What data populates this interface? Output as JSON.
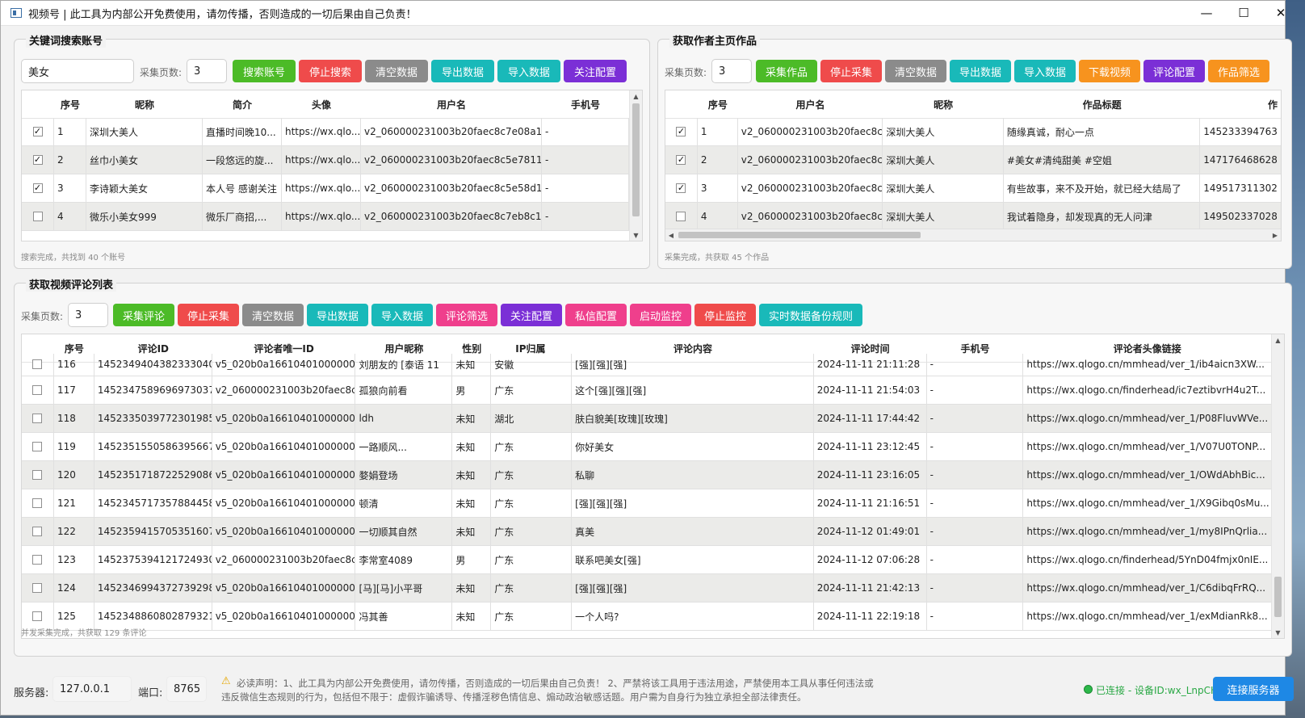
{
  "window": {
    "title": "视频号 | 此工具为内部公开免费使用，请勿传播，否则造成的一切后果由自己负责！"
  },
  "keyword_panel": {
    "title": "关键词搜索账号",
    "keyword": "美女",
    "pages_label": "采集页数:",
    "pages": "3",
    "buttons": [
      "搜索账号",
      "停止搜索",
      "清空数据",
      "导出数据",
      "导入数据",
      "关注配置"
    ],
    "columns": [
      "序号",
      "昵称",
      "简介",
      "头像",
      "用户名",
      "手机号"
    ],
    "rows": [
      {
        "checked": "✓",
        "no": "1",
        "nick": "深圳大美人",
        "intro": "直播时间晚10...",
        "avatar": "https://wx.qlo...",
        "user": "v2_060000231003b20faec8c7e08a1...",
        "phone": "-"
      },
      {
        "checked": "✓",
        "no": "2",
        "nick": "丝巾小美女",
        "intro": "一段悠远的旋...",
        "avatar": "https://wx.qlo...",
        "user": "v2_060000231003b20faec8c5e7811...",
        "phone": "-"
      },
      {
        "checked": "✓",
        "no": "3",
        "nick": "李诗颖大美女",
        "intro": "本人号 感谢关注",
        "avatar": "https://wx.qlo...",
        "user": "v2_060000231003b20faec8c5e58d1...",
        "phone": "-"
      },
      {
        "checked": "",
        "no": "4",
        "nick": "微乐小美女999",
        "intro": "微乐厂商招,...",
        "avatar": "https://wx.qlo...",
        "user": "v2_060000231003b20faec8c7eb8c1...",
        "phone": "-"
      }
    ],
    "status": "搜索完成，共找到 40 个账号"
  },
  "works_panel": {
    "title": "获取作者主页作品",
    "pages_label": "采集页数:",
    "pages": "3",
    "buttons": [
      "采集作品",
      "停止采集",
      "清空数据",
      "导出数据",
      "导入数据",
      "下载视频",
      "评论配置",
      "作品筛选"
    ],
    "columns": [
      "序号",
      "用户名",
      "昵称",
      "作品标题",
      "作"
    ],
    "rows": [
      {
        "checked": "✓",
        "no": "1",
        "user": "v2_060000231003b20faec8c...",
        "nick": "深圳大美人",
        "work_title": "随缘真诚，耐心一点",
        "id": "145233394763"
      },
      {
        "checked": "✓",
        "no": "2",
        "user": "v2_060000231003b20faec8c...",
        "nick": "深圳大美人",
        "work_title": "#美女#清纯甜美 #空姐",
        "id": "147176468628"
      },
      {
        "checked": "✓",
        "no": "3",
        "user": "v2_060000231003b20faec8c...",
        "nick": "深圳大美人",
        "work_title": "有些故事，来不及开始，就已经大结局了",
        "id": "149517311302"
      },
      {
        "checked": "",
        "no": "4",
        "user": "v2_060000231003b20faec8c...",
        "nick": "深圳大美人",
        "work_title": "我试着隐身，却发现真的无人问津",
        "id": "149502337028"
      }
    ],
    "status": "采集完成，共获取 45 个作品"
  },
  "comments_panel": {
    "title": "获取视频评论列表",
    "pages_label": "采集页数:",
    "pages": "3",
    "buttons": [
      "采集评论",
      "停止采集",
      "清空数据",
      "导出数据",
      "导入数据",
      "评论筛选",
      "关注配置",
      "私信配置",
      "启动监控",
      "停止监控",
      "实时数据备份规则"
    ],
    "columns": [
      "序号",
      "评论ID",
      "评论者唯一ID",
      "用户昵称",
      "性别",
      "IP归属",
      "评论内容",
      "评论时间",
      "手机号",
      "评论者头像链接"
    ],
    "partial_row": {
      "no": "116",
      "cid": "14523494043823330400",
      "uid": "v5_020b0a16610401000000...",
      "nick": "刘朋友的 [泰语 11",
      "gender": "未知",
      "ip": "安徽",
      "content": "[强][强][强]",
      "time": "2024-11-11 21:11:28",
      "phone": "-",
      "avatar": "https://wx.qlogo.cn/mmhead/ver_1/ib4aicn3XW..."
    },
    "rows": [
      {
        "checked": "",
        "no": "117",
        "cid": "14523475896969730372",
        "uid": "v2_060000231003b20faec8c...",
        "nick": "孤狼向前看",
        "gender": "男",
        "ip": "广东",
        "content": "这个[强][强][强]",
        "time": "2024-11-11 21:54:03",
        "phone": "-",
        "avatar": "https://wx.qlogo.cn/finderhead/ic7eztibvrH4u2T..."
      },
      {
        "checked": "",
        "no": "118",
        "cid": "14523350397723019859",
        "uid": "v5_020b0a16610401000000...",
        "nick": "ldh",
        "gender": "未知",
        "ip": "湖北",
        "content": "肤白貌美[玫瑰][玫瑰]",
        "time": "2024-11-11 17:44:42",
        "phone": "-",
        "avatar": "https://wx.qlogo.cn/mmhead/ver_1/P08FluvWVe..."
      },
      {
        "checked": "",
        "no": "119",
        "cid": "14523515505863956678",
        "uid": "v5_020b0a16610401000000...",
        "nick": "一路顺风...",
        "gender": "未知",
        "ip": "广东",
        "content": "你好美女",
        "time": "2024-11-11 23:12:45",
        "phone": "-",
        "avatar": "https://wx.qlogo.cn/mmhead/ver_1/V07U0TONP..."
      },
      {
        "checked": "",
        "no": "120",
        "cid": "14523517187225290862",
        "uid": "v5_020b0a16610401000000...",
        "nick": "婺娟登场",
        "gender": "未知",
        "ip": "广东",
        "content": "私聊",
        "time": "2024-11-11 23:16:05",
        "phone": "-",
        "avatar": "https://wx.qlogo.cn/mmhead/ver_1/OWdAbhBic..."
      },
      {
        "checked": "",
        "no": "121",
        "cid": "14523457173578844587",
        "uid": "v5_020b0a16610401000000...",
        "nick": "顿清",
        "gender": "未知",
        "ip": "广东",
        "content": "[强][强][强]",
        "time": "2024-11-11 21:16:51",
        "phone": "-",
        "avatar": "https://wx.qlogo.cn/mmhead/ver_1/X9Gibq0sMu..."
      },
      {
        "checked": "",
        "no": "122",
        "cid": "14523594157053516078",
        "uid": "v5_020b0a16610401000000...",
        "nick": "一切顺其自然",
        "gender": "未知",
        "ip": "广东",
        "content": "真美",
        "time": "2024-11-12 01:49:01",
        "phone": "-",
        "avatar": "https://wx.qlogo.cn/mmhead/ver_1/my8IPnQrlia..."
      },
      {
        "checked": "",
        "no": "123",
        "cid": "14523753941217249305",
        "uid": "v2_060000231003b20faec8c...",
        "nick": "李常室4089",
        "gender": "男",
        "ip": "广东",
        "content": "联系吧美女[强]",
        "time": "2024-11-12 07:06:28",
        "phone": "-",
        "avatar": "https://wx.qlogo.cn/finderhead/5YnD04fmjx0nIE..."
      },
      {
        "checked": "",
        "no": "124",
        "cid": "14523469943727392987",
        "uid": "v5_020b0a16610401000000...",
        "nick": "[马][马]小平哥",
        "gender": "未知",
        "ip": "广东",
        "content": "[强][强][强]",
        "time": "2024-11-11 21:42:13",
        "phone": "-",
        "avatar": "https://wx.qlogo.cn/mmhead/ver_1/C6dibqFrRQ..."
      },
      {
        "checked": "",
        "no": "125",
        "cid": "14523488608028793211",
        "uid": "v5_020b0a16610401000000...",
        "nick": "冯其善",
        "gender": "未知",
        "ip": "广东",
        "content": "一个人吗?",
        "time": "2024-11-11 22:19:18",
        "phone": "-",
        "avatar": "https://wx.qlogo.cn/mmhead/ver_1/exMdianRk8..."
      }
    ],
    "status": "并发采集完成，共获取 129 条评论"
  },
  "footer": {
    "server_label": "服务器:",
    "server": "127.0.0.1",
    "port_label": "端口:",
    "port": "8765",
    "notice_line1": "必读声明：1、此工具为内部公开免费使用，请勿传播，否则造成的一切后果由自己负责！ 2、严禁将该工具用于违法用途，严禁使用本工具从事任何违法或",
    "notice_line2": "违反微信生态规则的行为，包括但不限于：虚假诈骗诱导、传播淫秽色情信息、煽动政治敏感话题。用户需为自身行为独立承担全部法律责任。",
    "connection_status": "已连接 - 设备ID:wx_LnpCH",
    "connect_button": "连接服务器"
  },
  "colors": {
    "green": "#4cbb27",
    "red": "#ef4b4b",
    "gray": "#8b8b8b",
    "teal": "#19b9b9",
    "purple": "#7b2fd6",
    "orange": "#f7931e",
    "pink": "#ef3f8c",
    "blue": "#1e88e5"
  }
}
